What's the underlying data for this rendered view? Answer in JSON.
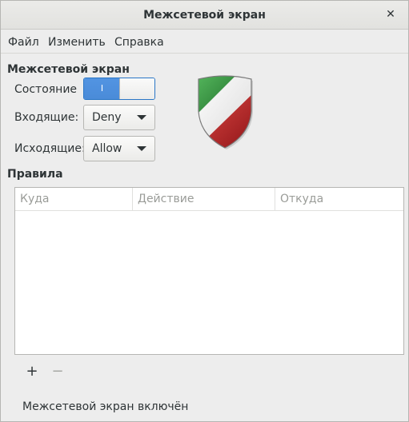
{
  "window": {
    "title": "Межсетевой экран",
    "close_icon": "close-icon"
  },
  "menu": {
    "file": "Файл",
    "edit": "Изменить",
    "help": "Справка"
  },
  "firewall": {
    "section_title": "Межсетевой экран",
    "state_label": "Состояние",
    "state_switch_text": "I",
    "state_on": true,
    "incoming_label": "Входящие:",
    "incoming_value": "Deny",
    "outgoing_label": "Исходящие:",
    "outgoing_value": "Allow",
    "shield_icon": "gufw-shield-icon"
  },
  "rules": {
    "section_title": "Правила",
    "columns": [
      "Куда",
      "Действие",
      "Откуда"
    ],
    "rows": [],
    "add_button": "+",
    "remove_button": "−"
  },
  "status": {
    "text": "Межсетевой экран включён"
  },
  "colors": {
    "accent": "#4a8bd8",
    "shield_green": "#2e8b3a",
    "shield_red": "#c0282e"
  }
}
